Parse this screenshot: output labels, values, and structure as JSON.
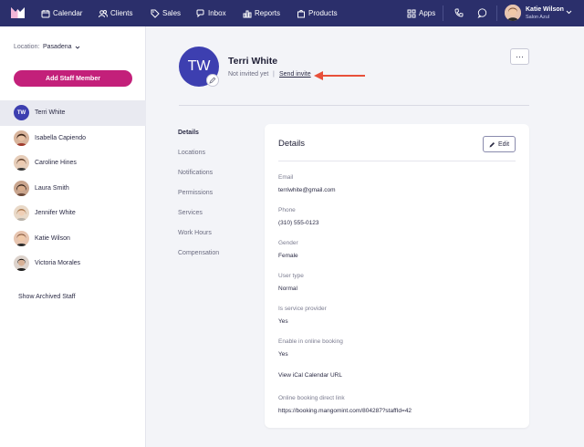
{
  "nav": {
    "items": [
      {
        "label": "Calendar",
        "icon": "calendar-icon"
      },
      {
        "label": "Clients",
        "icon": "users-icon"
      },
      {
        "label": "Sales",
        "icon": "tag-icon"
      },
      {
        "label": "Inbox",
        "icon": "chat-icon"
      },
      {
        "label": "Reports",
        "icon": "bar-chart-icon"
      },
      {
        "label": "Products",
        "icon": "bag-icon"
      }
    ],
    "apps_label": "Apps",
    "user_name": "Katie Wilson",
    "user_location": "Salon Azul"
  },
  "sidebar": {
    "location_label": "Location:",
    "location_value": "Pasadena",
    "add_button": "Add Staff Member",
    "staff": [
      {
        "name": "Terri White",
        "initials": "TW",
        "active": true
      },
      {
        "name": "Isabella Capiendo"
      },
      {
        "name": "Caroline Hines"
      },
      {
        "name": "Laura Smith"
      },
      {
        "name": "Jennifer White"
      },
      {
        "name": "Katie Wilson"
      },
      {
        "name": "Victoria Morales"
      }
    ],
    "archived_link": "Show Archived Staff"
  },
  "profile": {
    "initials": "TW",
    "name": "Terri White",
    "status": "Not invited yet",
    "separator": "|",
    "invite_link": "Send invite",
    "more": "···"
  },
  "subnav": [
    "Details",
    "Locations",
    "Notifications",
    "Permissions",
    "Services",
    "Work Hours",
    "Compensation"
  ],
  "details": {
    "title": "Details",
    "edit_label": "Edit",
    "fields": [
      {
        "label": "Email",
        "value": "terriwhite@gmail.com"
      },
      {
        "label": "Phone",
        "value": "(310) 555-0123"
      },
      {
        "label": "Gender",
        "value": "Female"
      },
      {
        "label": "User type",
        "value": "Normal"
      },
      {
        "label": "Is service provider",
        "value": "Yes"
      },
      {
        "label": "Enable in online booking",
        "value": "Yes"
      }
    ],
    "ical_link": "View iCal Calendar URL",
    "booking_label": "Online booking direct link",
    "booking_url": "https://booking.mangomint.com/804287?staffId=42"
  },
  "colors": {
    "nav_bg": "#2b2f6b",
    "accent": "#c3207a",
    "avatar": "#3d3fb0",
    "arrow": "#e8503a"
  }
}
